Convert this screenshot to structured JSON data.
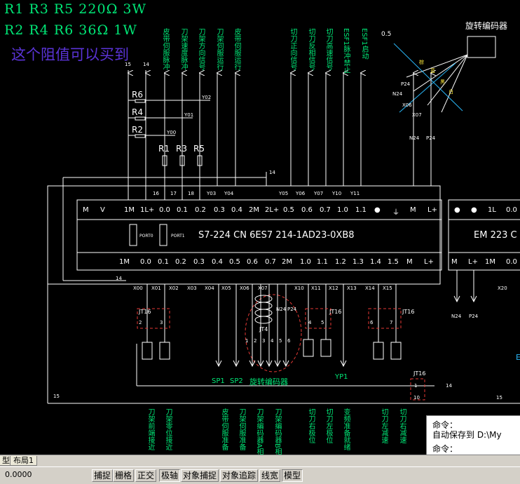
{
  "header": {
    "line1": "R1 R3 R5 220Ω  3W",
    "line2": "R2 R4 R6 36Ω  1W",
    "note": "这个阻值可以买到"
  },
  "diagram": {
    "plc_label": "S7-224 CN  6ES7 214-1AD23-0XB8",
    "em_label": "EM 223 C",
    "port0": "PORT0",
    "port1": "PORT1",
    "plc_top_terms": [
      "M",
      "V",
      "1M",
      "1L+",
      "0.0",
      "0.1",
      "0.2",
      "0.3",
      "0.4",
      "2M",
      "2L+",
      "0.5",
      "0.6",
      "0.7",
      "1.0",
      "1.1",
      "●",
      "⏚",
      "M",
      "L+"
    ],
    "plc_bottom_terms": [
      "1M",
      "0.0",
      "0.1",
      "0.2",
      "0.3",
      "0.4",
      "0.5",
      "0.6",
      "0.7",
      "2M",
      "1.0",
      "1.1",
      "1.2",
      "1.3",
      "1.4",
      "1.5",
      "M",
      "L+"
    ],
    "em_top_terms": [
      "●",
      "●",
      "1L",
      "0.0"
    ],
    "em_bottom_terms": [
      "M",
      "L+",
      "1M",
      "0.0"
    ],
    "top_wire_nums": [
      "16",
      "17",
      "18",
      "Y03",
      "Y04",
      "Y05",
      "Y06",
      "Y07",
      "Y10",
      "Y11"
    ],
    "x_wire_nums": [
      "X00",
      "X01",
      "X02",
      "X03",
      "X04",
      "X05",
      "X06",
      "X07",
      "X10",
      "X11",
      "X12",
      "X13",
      "X14",
      "X15",
      "X20"
    ],
    "top_signals": [
      "皮带伺服脉冲",
      "刀架速度脉冲",
      "刀架方向信号",
      "刀架伺服运行",
      "皮带伺服运行",
      "切刀正向信号",
      "切刀反相信号",
      "切刀高速信号",
      "ESF1脉冲禁止",
      "ESF1启动"
    ],
    "bottom_signals": [
      "刀架前端接近",
      "刀架零位接近",
      "皮带伺服准备",
      "刀架伺服准备",
      "刀架编码器A相",
      "刀架编码器B相",
      "切刀右极位",
      "切刀左极位",
      "变频准备就绪",
      "切刀左减速",
      "切刀右减速"
    ],
    "resistors_left": [
      "R6",
      "R4",
      "R2"
    ],
    "resistors_mid": [
      "R1",
      "R3",
      "R5"
    ],
    "y_labels": [
      "Y02",
      "Y01",
      "Y00"
    ],
    "wire_15": "15",
    "wire_14": "14",
    "n24": "N24",
    "p24": "P24",
    "jt16": "JT16",
    "jt4": "JT4",
    "encoder_title": "旋转编码器",
    "encoder_angle": "0.5",
    "encoder_wires": [
      "P24",
      "N24",
      "X06",
      "X07"
    ],
    "encoder_colors": [
      "棕",
      "蓝",
      "黑",
      "白"
    ],
    "sp_labels": [
      "SP1",
      "SP2"
    ],
    "encoder_bottom": "旋转编码器",
    "yp1": "YP1",
    "jt16_nums": [
      "2",
      "3",
      "4",
      "5",
      "6",
      "7"
    ],
    "jt4_nums": [
      "1",
      "2",
      "3",
      "4",
      "5",
      "6"
    ],
    "jt16_br": [
      "1",
      "10"
    ],
    "right_14": "14",
    "right_15": "15",
    "e_letter": "E"
  },
  "command": {
    "line1": "命令：",
    "line2": "自动保存到 D:\\My",
    "line3": "命令："
  },
  "tabs": [
    "型",
    "布局1"
  ],
  "status": {
    "coords": "0.0000",
    "buttons": [
      "捕捉",
      "栅格",
      "正交",
      "极轴",
      "对象捕捉",
      "对象追踪",
      "线宽",
      "模型"
    ]
  }
}
